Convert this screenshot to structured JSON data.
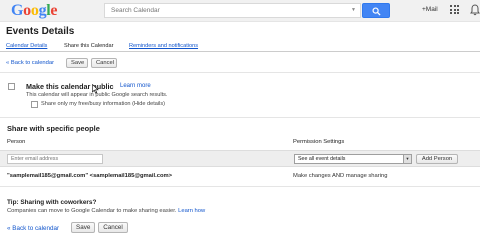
{
  "header": {
    "logo_text": "Google",
    "search_placeholder": "Search Calendar",
    "plus_mail": "+Mail",
    "icons": [
      "search-icon",
      "apps-grid-icon",
      "bell-icon"
    ]
  },
  "page": {
    "title": "Events Details",
    "tabs": [
      {
        "label": "Calendar Details",
        "active": false
      },
      {
        "label": "Share this Calendar",
        "active": true
      },
      {
        "label": "Reminders and notifications",
        "active": false
      }
    ]
  },
  "toolbar_top": {
    "back_label": "« Back to calendar",
    "save_label": "Save",
    "cancel_label": "Cancel"
  },
  "public": {
    "label": "Make this calendar public",
    "learn_more": "Learn more",
    "description": "This calendar will appear in public Google search results.",
    "freebusy_label": "Share only my free/busy information (Hide details)"
  },
  "sharing": {
    "heading": "Share with specific people",
    "col_person": "Person",
    "col_permission": "Permission Settings",
    "email_placeholder": "Enter email address",
    "permission_selected": "See all event details",
    "add_person_label": "Add Person",
    "entries": [
      {
        "person": "\"samplemail185@gmail.com\" <samplemail185@gmail.com>",
        "permission": "Make changes AND manage sharing"
      }
    ]
  },
  "tip": {
    "heading": "Tip: Sharing with coworkers?",
    "body": "Companies can move to Google Calendar to make sharing easier.",
    "learn_how": "Learn how"
  },
  "toolbar_bottom": {
    "back_label": "« Back to calendar",
    "save_label": "Save",
    "cancel_label": "Cancel"
  },
  "colors": {
    "accent_blue": "#4285f4",
    "link_blue": "#1155cc",
    "row_shade": "#eeeeee"
  }
}
